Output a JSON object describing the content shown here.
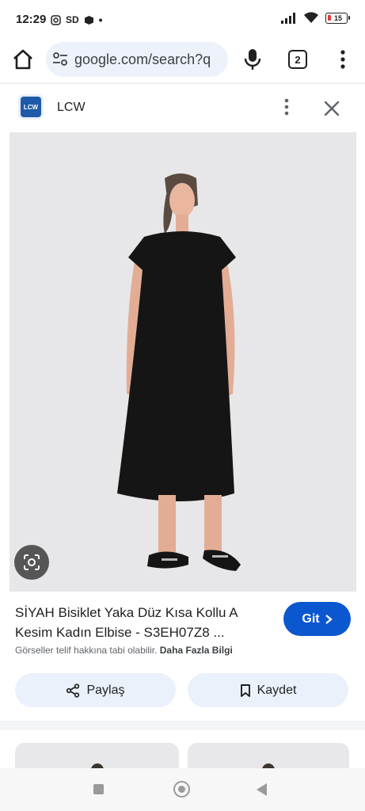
{
  "status_bar": {
    "time": "12:29",
    "sd_label": "SD",
    "battery_level": "15",
    "icons": [
      "instagram-icon",
      "sd-card-icon",
      "package-icon",
      "dot-icon",
      "signal-icon",
      "wifi-icon",
      "battery-icon"
    ]
  },
  "browser": {
    "url": "google.com/search?q",
    "tab_count": "2",
    "icons": [
      "home-icon",
      "site-settings-icon",
      "mic-icon",
      "tabs-icon",
      "more-vert-icon"
    ]
  },
  "source": {
    "logo_text": "LCW",
    "name": "LCW"
  },
  "product": {
    "title": "SİYAH Bisiklet Yaka Düz Kısa Kollu A Kesim Kadın Elbise - S3EH07Z8 ...",
    "go_label": "Git",
    "copyright_text": "Görseller telif hakkına tabi olabilir.",
    "more_info": "Daha Fazla Bilgi"
  },
  "actions": {
    "share_label": "Paylaş",
    "save_label": "Kaydet"
  },
  "colors": {
    "accent": "#0b57d0",
    "chip_bg": "#eaf1fb",
    "omnibox_bg": "#edf2fa",
    "brand_logo": "#1e5aa8"
  }
}
